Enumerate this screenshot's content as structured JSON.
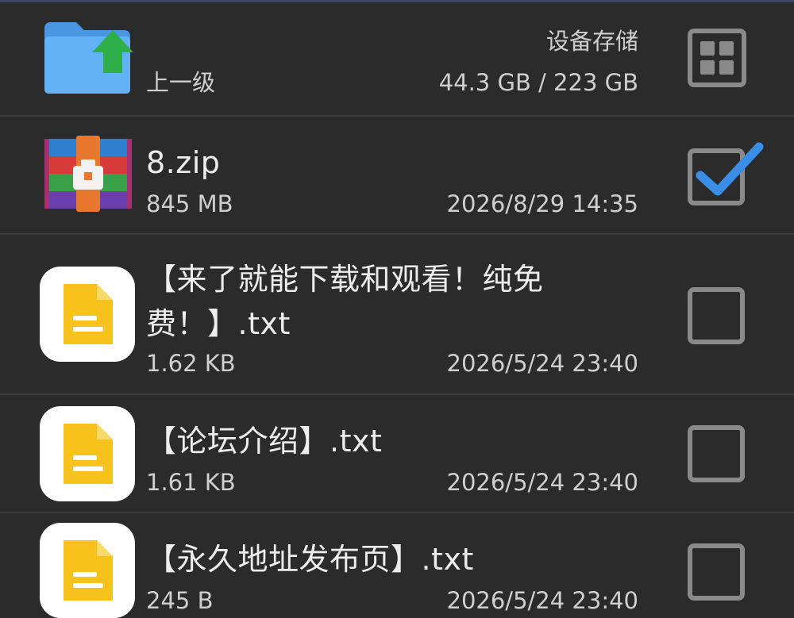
{
  "header": {
    "parent_label": "上一级",
    "storage_label": "设备存储",
    "storage_usage": "44.3 GB / 223 GB",
    "view_toggle_icon": "grid-view-icon"
  },
  "files": [
    {
      "name": "8.zip",
      "size": "845 MB",
      "date": "2026/8/29 14:35",
      "checked": true,
      "icon": "zip-archive-icon"
    },
    {
      "name": "【来了就能下载和观看！纯免",
      "name_line2": "费！】.txt",
      "size": "1.62 KB",
      "date": "2026/5/24 23:40",
      "checked": false,
      "icon": "text-file-icon"
    },
    {
      "name": "【论坛介绍】.txt",
      "size": "1.61 KB",
      "date": "2026/5/24 23:40",
      "checked": false,
      "icon": "text-file-icon"
    },
    {
      "name": "【永久地址发布页】.txt",
      "size": "245 B",
      "date": "2026/5/24 23:40",
      "checked": false,
      "icon": "text-file-icon"
    }
  ],
  "colors": {
    "background": "#2b2b2b",
    "check_accent": "#3a8ee8",
    "folder_blue": "#5aa9f0",
    "up_arrow_green": "#2eaf4a",
    "doc_yellow": "#f7c21c"
  }
}
